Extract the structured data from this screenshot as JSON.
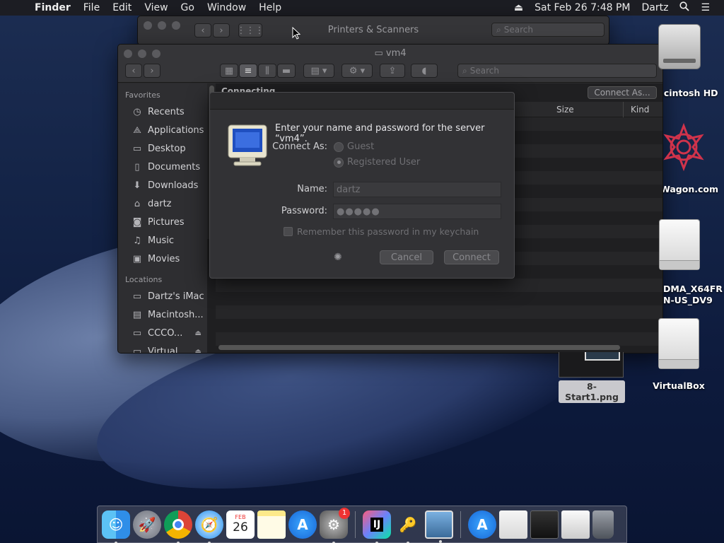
{
  "menubar": {
    "apple": "",
    "items": [
      "Finder",
      "File",
      "Edit",
      "View",
      "Go",
      "Window",
      "Help"
    ],
    "datetime": "Sat Feb 26  7:48 PM",
    "user": "Dartz"
  },
  "printers_window": {
    "title": "Printers & Scanners",
    "search_placeholder": "Search"
  },
  "finder_window": {
    "title": "vm4",
    "search_placeholder": "Search",
    "status": "Connecting",
    "connect_as_button": "Connect As...",
    "columns": [
      "Size",
      "Kind"
    ],
    "favorites_header": "Favorites",
    "favorites": [
      {
        "label": "Recents",
        "icon": "clock-icon"
      },
      {
        "label": "Applications",
        "icon": "applications-icon"
      },
      {
        "label": "Desktop",
        "icon": "desktop-icon"
      },
      {
        "label": "Documents",
        "icon": "document-icon"
      },
      {
        "label": "Downloads",
        "icon": "download-icon"
      },
      {
        "label": "dartz",
        "icon": "home-icon"
      },
      {
        "label": "Pictures",
        "icon": "camera-icon"
      },
      {
        "label": "Music",
        "icon": "music-icon"
      },
      {
        "label": "Movies",
        "icon": "film-icon"
      }
    ],
    "locations_header": "Locations",
    "locations": [
      {
        "label": "Dartz's iMac",
        "icon": "imac-icon"
      },
      {
        "label": "Macintosh...",
        "icon": "disk-icon"
      },
      {
        "label": "CCCO...",
        "icon": "disk-icon"
      },
      {
        "label": "Virtual...",
        "icon": "disk-icon"
      }
    ]
  },
  "dialog": {
    "message": "Enter your name and password for the server “vm4”.",
    "connect_as_label": "Connect As:",
    "guest_label": "Guest",
    "registered_label": "Registered User",
    "name_label": "Name:",
    "name_value": "dartz",
    "password_label": "Password:",
    "password_value": "●●●●●",
    "remember_label": "Remember this password in my keychain",
    "cancel_label": "Cancel",
    "connect_label": "Connect"
  },
  "desktop_icons": {
    "macintosh_hd": "Macintosh HD",
    "website": "Wagon.com",
    "iso_line1": "DMA_X64FR",
    "iso_line2": "N-US_DV9",
    "png": "8-Start1.png",
    "virtualbox": "VirtualBox"
  },
  "dock": {
    "calendar_month": "FEB",
    "calendar_day": "26",
    "sysprefs_badge": "1"
  }
}
